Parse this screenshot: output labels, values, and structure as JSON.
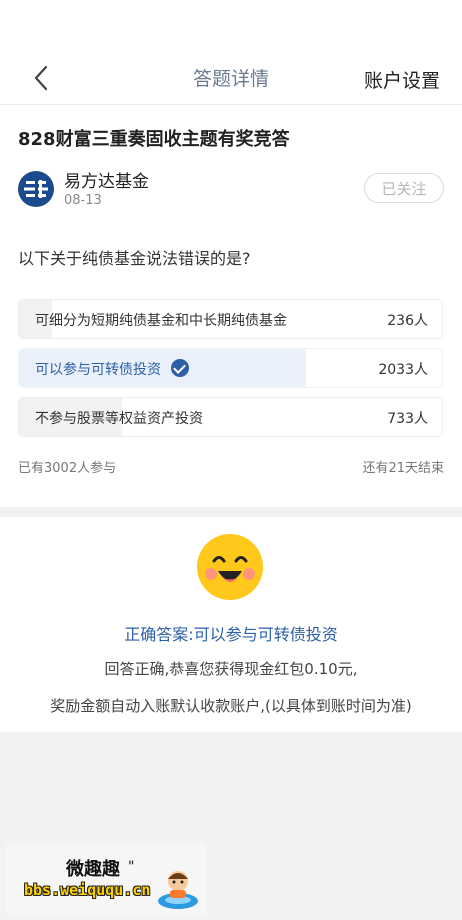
{
  "header": {
    "title": "答题详情",
    "right_action": "账户设置"
  },
  "event": {
    "title": "828财富三重奏固收主题有奖竞答",
    "publisher": "易方达基金",
    "date": "08-13",
    "follow_status": "已关注"
  },
  "quiz": {
    "question": "以下关于纯债基金说法错误的是?",
    "options": [
      {
        "label": "可细分为短期纯债基金和中长期纯债基金",
        "count": "236人",
        "share": 0.0787,
        "correct": false
      },
      {
        "label": "可以参与可转债投资",
        "count": "2033人",
        "share": 0.6777,
        "correct": true
      },
      {
        "label": "不参与股票等权益资产投资",
        "count": "733人",
        "share": 0.2443,
        "correct": false
      }
    ],
    "participants": "已有3002人参与",
    "remaining": "还有21天结束"
  },
  "result": {
    "answer": "正确答案:可以参与可转债投资",
    "message": "回答正确,恭喜您获得现金红包0.10元,",
    "note": "奖励金额自动入账默认收款账户,(以具体到账时间为准)"
  },
  "watermark": {
    "title": "微趣趣",
    "url": "bbs.weiququ.cn",
    "mark": "\""
  },
  "colors": {
    "accent": "#2c5fa8",
    "title_gray": "#6a7a8e",
    "emoji_yellow": "#ffc81a"
  }
}
